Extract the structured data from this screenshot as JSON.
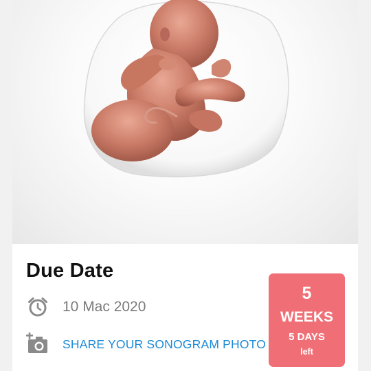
{
  "card": {
    "title": "Due Date",
    "due_date": "10 Mac 2020",
    "share_label": "SHARE YOUR SONOGRAM PHOTO"
  },
  "countdown": {
    "number": "5",
    "weeks_label": "WEEKS",
    "days_label": "5 DAYS",
    "left_label": "left"
  },
  "icons": {
    "date": "alarm-clock-icon",
    "share": "add-photo-camera-icon"
  },
  "colors": {
    "accent_link": "#1a8ad6",
    "countdown_bg": "#f06f76",
    "icon_gray": "#8a8a8a"
  }
}
